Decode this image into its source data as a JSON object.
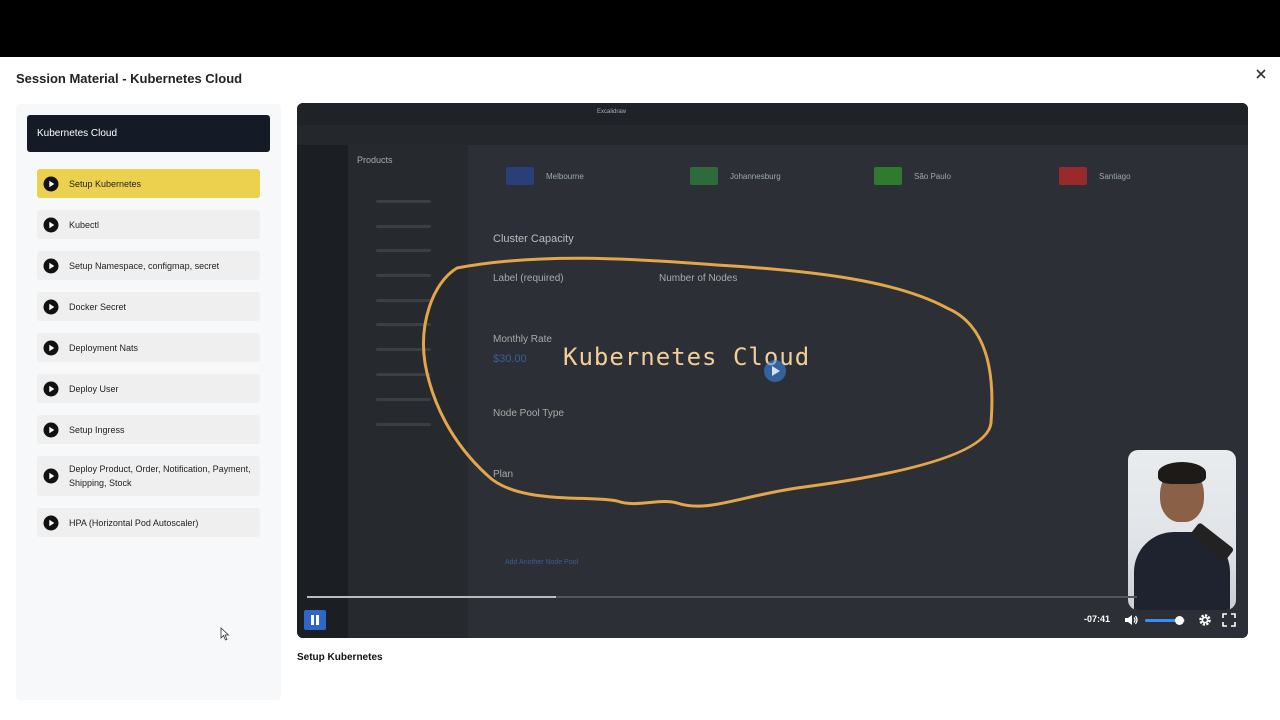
{
  "modal": {
    "title": "Session Material - Kubernetes Cloud",
    "close_icon": "close-icon"
  },
  "sidebar": {
    "section_title": "Kubernetes Cloud",
    "lessons": [
      {
        "label": "Setup Kubernetes",
        "active": true
      },
      {
        "label": "Kubectl"
      },
      {
        "label": "Setup Namespace, configmap, secret"
      },
      {
        "label": "Docker Secret"
      },
      {
        "label": "Deployment Nats"
      },
      {
        "label": "Deploy User"
      },
      {
        "label": "Setup Ingress"
      },
      {
        "label": "Deploy Product, Order, Notification, Payment, Shipping, Stock"
      },
      {
        "label": "HPA (Horizontal Pod Autoscaler)"
      }
    ],
    "colors": {
      "header_bg": "#151b26",
      "active_bg": "#ecd14e",
      "item_bg": "#efefef"
    }
  },
  "video": {
    "browser_title": "Excalidraw",
    "app": {
      "products_label": "Products",
      "regions": [
        "Melbourne",
        "Johannesburg",
        "São Paulo",
        "Santiago"
      ],
      "cluster_capacity": "Cluster Capacity",
      "label_required": "Label (required)",
      "number_of_nodes": "Number of Nodes",
      "monthly_rate": "Monthly Rate",
      "price": "$30.00",
      "node_pool_type": "Node Pool Type",
      "plan": "Plan",
      "add_node_pool": "Add Another Node Pool"
    },
    "overlay_text": "Kubernetes Cloud",
    "controls": {
      "time_remaining": "-07:41",
      "progress": 0.3,
      "volume": 0.85,
      "icons": [
        "pause-icon",
        "volume-icon",
        "settings-icon",
        "fullscreen-icon"
      ]
    },
    "caption": "Setup Kubernetes"
  }
}
